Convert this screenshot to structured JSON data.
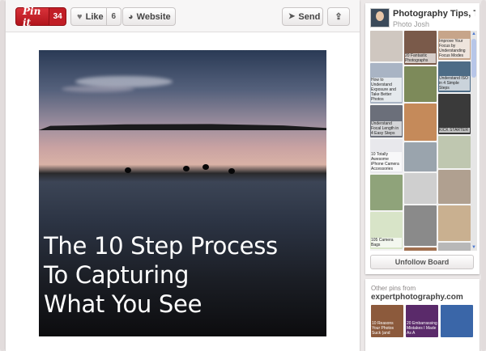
{
  "action_bar": {
    "pin_label": "Pin it",
    "pin_count": "34",
    "like_label": "Like",
    "like_count": "6",
    "website_label": "Website",
    "send_label": "Send",
    "icons": [
      "heart-icon",
      "globe-icon",
      "send-icon",
      "share-icon"
    ]
  },
  "pin": {
    "title_lines": [
      "The 10 Step Process",
      "To Capturing",
      "What You See"
    ]
  },
  "board": {
    "title": "Photography Tips, Tri...",
    "owner": "Photo Josh",
    "thumbs": [
      {
        "text": "",
        "color": "#cfc7c0"
      },
      {
        "text": "20 Fantastic Photographs",
        "color": "#7a5a4a"
      },
      {
        "text": "Improve Your Focus by Understanding Focus Modes",
        "color": "#c7a58a"
      },
      {
        "text": "How to Understand Exposure and Take Better Photos",
        "color": "#a9b4c4"
      },
      {
        "text": "",
        "color": "#7d8a5a"
      },
      {
        "text": "Understand ISO in 4 Simple Steps",
        "color": "#4d6c86"
      },
      {
        "text": "Understand Focal Length in 4 Easy Steps",
        "color": "#6b6f7a"
      },
      {
        "text": "",
        "color": "#c58a5a"
      },
      {
        "text": "KICK STARTER",
        "color": "#3a3a3a"
      },
      {
        "text": "10 Totally Awesome iPhone Camera Accessories",
        "color": "#e8e8ec"
      },
      {
        "text": "",
        "color": "#9aa4ad"
      },
      {
        "text": "",
        "color": "#bfc7b0"
      },
      {
        "text": "",
        "color": "#8fa37a"
      },
      {
        "text": "",
        "color": "#cfcfcf"
      },
      {
        "text": "",
        "color": "#b0a090"
      },
      {
        "text": "105 Camera Bags",
        "color": "#d8e4c8"
      },
      {
        "text": "",
        "color": "#8a8a8a"
      },
      {
        "text": "",
        "color": "#c9b090"
      },
      {
        "text": "",
        "color": "#9a9a9a"
      },
      {
        "text": "",
        "color": "#a07050"
      },
      {
        "text": "",
        "color": "#b8b8b8"
      }
    ],
    "unfollow_label": "Unfollow Board"
  },
  "others": {
    "label": "Other pins from",
    "domain": "expertphotography.com",
    "thumbs": [
      {
        "caption": "10 Reasons Your Photos Suck (and",
        "color": "#8c5a3c"
      },
      {
        "caption": "20 Embarrassing Mistakes I Made As A",
        "color": "#5a2a6a"
      },
      {
        "caption": "",
        "color": "#3a66a8"
      }
    ]
  },
  "colors": {
    "pin_red": "#c11e26",
    "card_bg": "#ffffff",
    "page_bg": "#ece8e8"
  }
}
